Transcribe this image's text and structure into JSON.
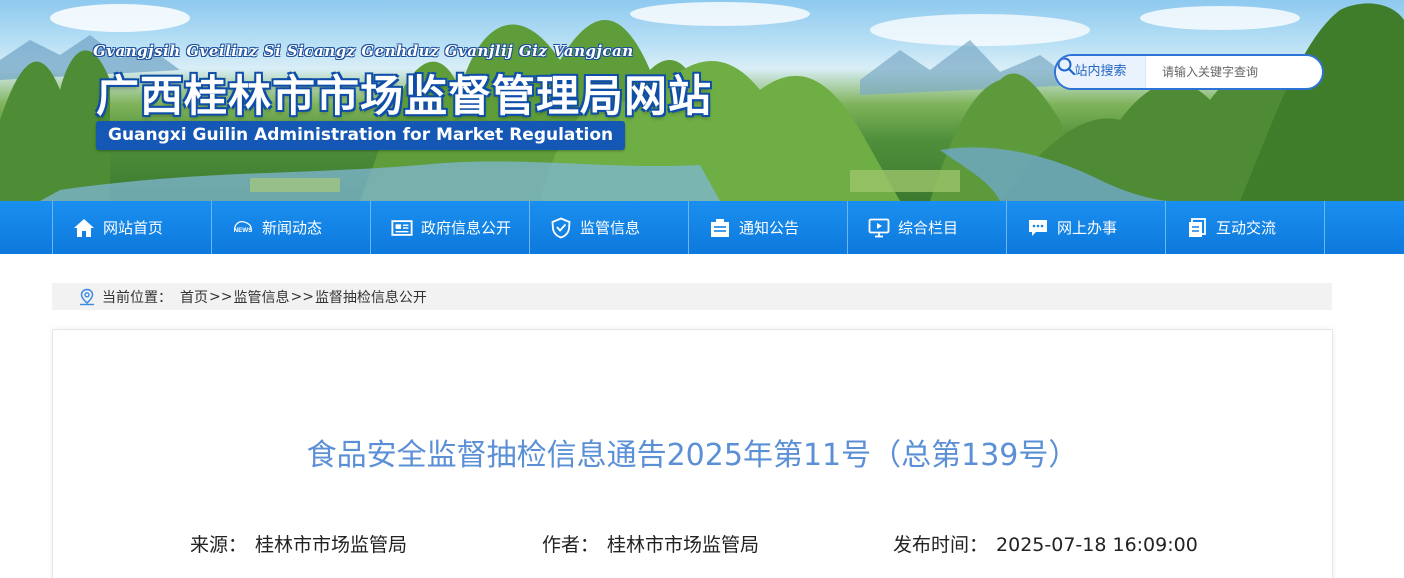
{
  "header": {
    "pinyin": "Gvangjsih Gveilinz Si Sicangz Genhduz Gvanjlij Giz Vangjcan",
    "title": "广西桂林市市场监督管理局网站",
    "english": "Guangxi Guilin Administration for Market Regulation",
    "search": {
      "label": "站内搜索",
      "placeholder": "请输入关键字查询",
      "button_icon": "search-icon"
    }
  },
  "nav": {
    "items": [
      {
        "label": "网站首页",
        "icon": "home-icon"
      },
      {
        "label": "新闻动态",
        "icon": "news-icon"
      },
      {
        "label": "政府信息公开",
        "icon": "newspaper-icon"
      },
      {
        "label": "监管信息",
        "icon": "shield-icon"
      },
      {
        "label": "通知公告",
        "icon": "notice-icon"
      },
      {
        "label": "综合栏目",
        "icon": "monitor-icon"
      },
      {
        "label": "网上办事",
        "icon": "chat-icon"
      },
      {
        "label": "互动交流",
        "icon": "documents-icon"
      }
    ]
  },
  "breadcrumb": {
    "prefix": "当前位置：",
    "items": [
      "首页",
      "监管信息",
      "监督抽检信息公开"
    ],
    "separator": ">>"
  },
  "article": {
    "title": "食品安全监督抽检信息通告2025年第11号（总第139号）",
    "source_label": "来源：",
    "source": "桂林市市场监管局",
    "author_label": "作者：",
    "author": "桂林市市场监管局",
    "time_label": "发布时间：",
    "time": "2025-07-18 16:09:00"
  },
  "colors": {
    "nav_bg": "#1283e6",
    "title_blue": "#5b8fd6",
    "brand_blue": "#1557b5"
  }
}
